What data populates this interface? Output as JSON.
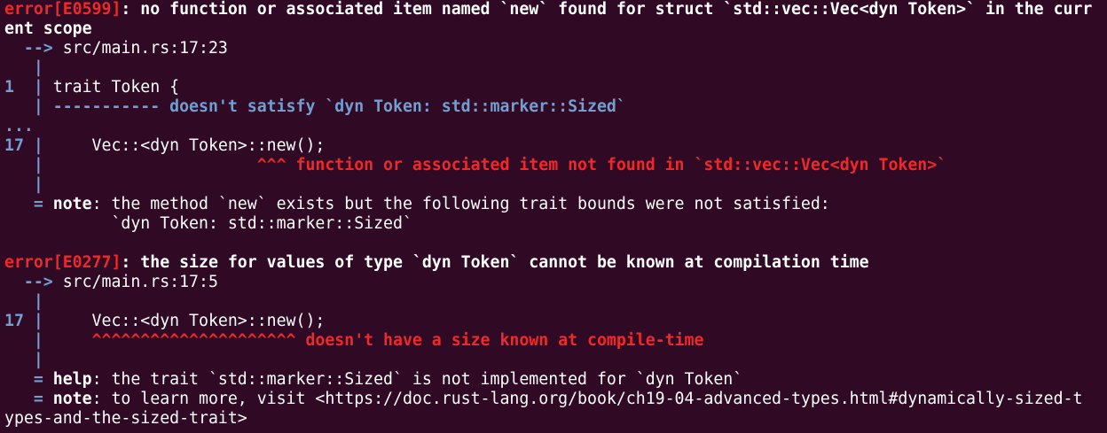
{
  "colors": {
    "background": "#300a24",
    "text": "#ffffff",
    "error": "#ef2929",
    "gutter": "#729fcf"
  },
  "lines": [
    [
      {
        "t": "error[E0599]",
        "c": "red"
      },
      {
        "t": ": no function or associated item named `new` found for struct `std::vec::Vec<dyn Token>` in the curr",
        "c": "b"
      }
    ],
    [
      {
        "t": "ent scope",
        "c": "b"
      }
    ],
    [
      {
        "t": "  --> ",
        "c": "blue"
      },
      {
        "t": "src/main.rs:17:23",
        "c": ""
      }
    ],
    [
      {
        "t": "   |",
        "c": "blue"
      }
    ],
    [
      {
        "t": "1  |",
        "c": "blue"
      },
      {
        "t": " trait Token {",
        "c": ""
      }
    ],
    [
      {
        "t": "   | ----------- doesn't satisfy `dyn Token: std::marker::Sized`",
        "c": "blue"
      }
    ],
    [
      {
        "t": "...",
        "c": "blue"
      }
    ],
    [
      {
        "t": "17 |",
        "c": "blue"
      },
      {
        "t": "     Vec::<dyn Token>::new();",
        "c": ""
      }
    ],
    [
      {
        "t": "   |",
        "c": "blue"
      },
      {
        "t": "                      ^^^ function or associated item not found in `std::vec::Vec<dyn Token>`",
        "c": "red"
      }
    ],
    [
      {
        "t": "   |",
        "c": "blue"
      }
    ],
    [
      {
        "t": "   = ",
        "c": "blue"
      },
      {
        "t": "note",
        "c": "b"
      },
      {
        "t": ": the method `new` exists but the following trait bounds were not satisfied:",
        "c": ""
      }
    ],
    [
      {
        "t": "           `dyn Token: std::marker::Sized`",
        "c": ""
      }
    ],
    [
      {
        "t": "",
        "c": ""
      }
    ],
    [
      {
        "t": "error[E0277]",
        "c": "red"
      },
      {
        "t": ": the size for values of type `dyn Token` cannot be known at compilation time",
        "c": "b"
      }
    ],
    [
      {
        "t": "  --> ",
        "c": "blue"
      },
      {
        "t": "src/main.rs:17:5",
        "c": ""
      }
    ],
    [
      {
        "t": "   |",
        "c": "blue"
      }
    ],
    [
      {
        "t": "17 |",
        "c": "blue"
      },
      {
        "t": "     Vec::<dyn Token>::new();",
        "c": ""
      }
    ],
    [
      {
        "t": "   |",
        "c": "blue"
      },
      {
        "t": "     ^^^^^^^^^^^^^^^^^^^^^ doesn't have a size known at compile-time",
        "c": "red"
      }
    ],
    [
      {
        "t": "   |",
        "c": "blue"
      }
    ],
    [
      {
        "t": "   = ",
        "c": "blue"
      },
      {
        "t": "help",
        "c": "b"
      },
      {
        "t": ": the trait `std::marker::Sized` is not implemented for `dyn Token`",
        "c": ""
      }
    ],
    [
      {
        "t": "   = ",
        "c": "blue"
      },
      {
        "t": "note",
        "c": "b"
      },
      {
        "t": ": to learn more, visit <https://doc.rust-lang.org/book/ch19-04-advanced-types.html#dynamically-sized-t",
        "c": ""
      }
    ],
    [
      {
        "t": "ypes-and-the-sized-trait>",
        "c": ""
      }
    ]
  ]
}
